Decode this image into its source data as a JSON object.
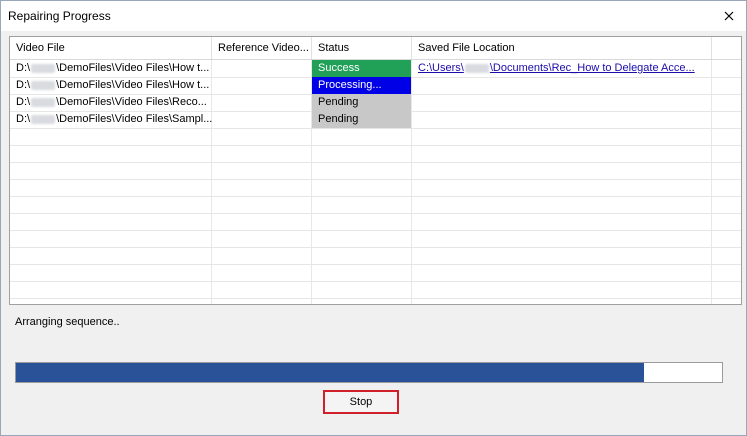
{
  "window": {
    "title": "Repairing Progress"
  },
  "table": {
    "columns": [
      "Video File",
      "Reference Video...",
      "Status",
      "Saved File Location"
    ],
    "rows": [
      {
        "file_prefix": "D:\\",
        "file_suffix": "\\DemoFiles\\Video Files\\How t...",
        "reference": "",
        "status": "Success",
        "status_kind": "success",
        "loc_prefix": "C:\\Users\\",
        "loc_suffix": "\\Documents\\Rec_How to Delegate Acce..."
      },
      {
        "file_prefix": "D:\\",
        "file_suffix": "\\DemoFiles\\Video Files\\How t...",
        "reference": "",
        "status": "Processing...",
        "status_kind": "processing",
        "loc_prefix": "",
        "loc_suffix": ""
      },
      {
        "file_prefix": "D:\\",
        "file_suffix": "\\DemoFiles\\Video Files\\Reco...",
        "reference": "",
        "status": "Pending",
        "status_kind": "pending",
        "loc_prefix": "",
        "loc_suffix": ""
      },
      {
        "file_prefix": "D:\\",
        "file_suffix": "\\DemoFiles\\Video Files\\Sampl...",
        "reference": "",
        "status": "Pending",
        "status_kind": "pending",
        "loc_prefix": "",
        "loc_suffix": ""
      }
    ]
  },
  "status_message": "Arranging sequence..",
  "progress": {
    "fraction": 0.89,
    "fill_color": "#2a5299"
  },
  "stop_button": {
    "label": "Stop"
  },
  "colors": {
    "success": "#21a058",
    "processing": "#0000e6",
    "pending": "#c8c8c8",
    "stop_border": "#d0202a",
    "link": "#1a0dab"
  },
  "icons": {
    "close": "close-icon"
  }
}
